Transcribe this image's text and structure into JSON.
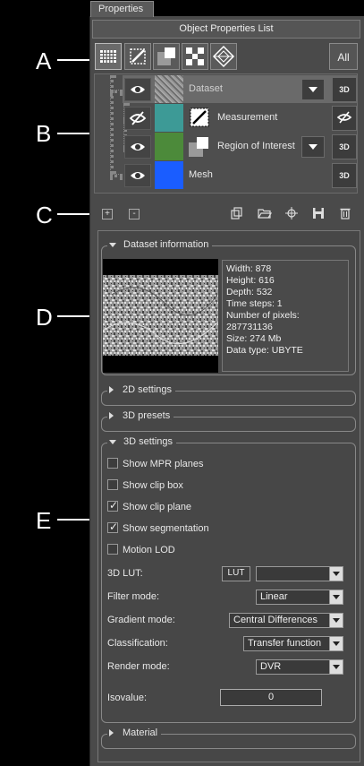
{
  "tab": {
    "label": "Properties"
  },
  "panel": {
    "title": "Object Properties List"
  },
  "toolbar": {
    "all_label": "All"
  },
  "callouts": {
    "a": "A",
    "b": "B",
    "c": "C",
    "d": "D",
    "e": "E"
  },
  "objects": [
    {
      "label": "Dataset",
      "btn": "3D",
      "color": "#808080"
    },
    {
      "label": "Measurement",
      "btn": "",
      "color": "#3d9a96"
    },
    {
      "label": "Region of Interest",
      "btn": "3D",
      "color": "#4c8a3a"
    },
    {
      "label": "Mesh",
      "btn": "3D",
      "color": "#1a5dff"
    }
  ],
  "actions": {
    "add": "+",
    "remove": "-"
  },
  "dataset_info": {
    "title": "Dataset information",
    "lines": [
      "Width: 878",
      "Height: 616",
      "Depth: 532",
      "Time steps: 1",
      "Number of pixels:",
      "287731136",
      "Size: 274 Mb",
      "Data type: UBYTE"
    ]
  },
  "groups": {
    "settings_2d": "2D settings",
    "presets_3d": "3D presets",
    "settings_3d": "3D settings",
    "material": "Material"
  },
  "settings_3d": {
    "checkboxes": [
      {
        "label": "Show MPR planes",
        "checked": false
      },
      {
        "label": "Show clip box",
        "checked": false
      },
      {
        "label": "Show clip plane",
        "checked": true
      },
      {
        "label": "Show segmentation",
        "checked": true
      },
      {
        "label": "Motion LOD",
        "checked": false
      }
    ],
    "lut_label": "3D LUT:",
    "lut_button": "LUT",
    "lut_value": "",
    "filter_label": "Filter mode:",
    "filter_value": "Linear",
    "gradient_label": "Gradient mode:",
    "gradient_value": "Central Differences",
    "classification_label": "Classification:",
    "classification_value": "Transfer function",
    "render_label": "Render mode:",
    "render_value": "DVR",
    "iso_label": "Isovalue:",
    "iso_value": "0"
  }
}
